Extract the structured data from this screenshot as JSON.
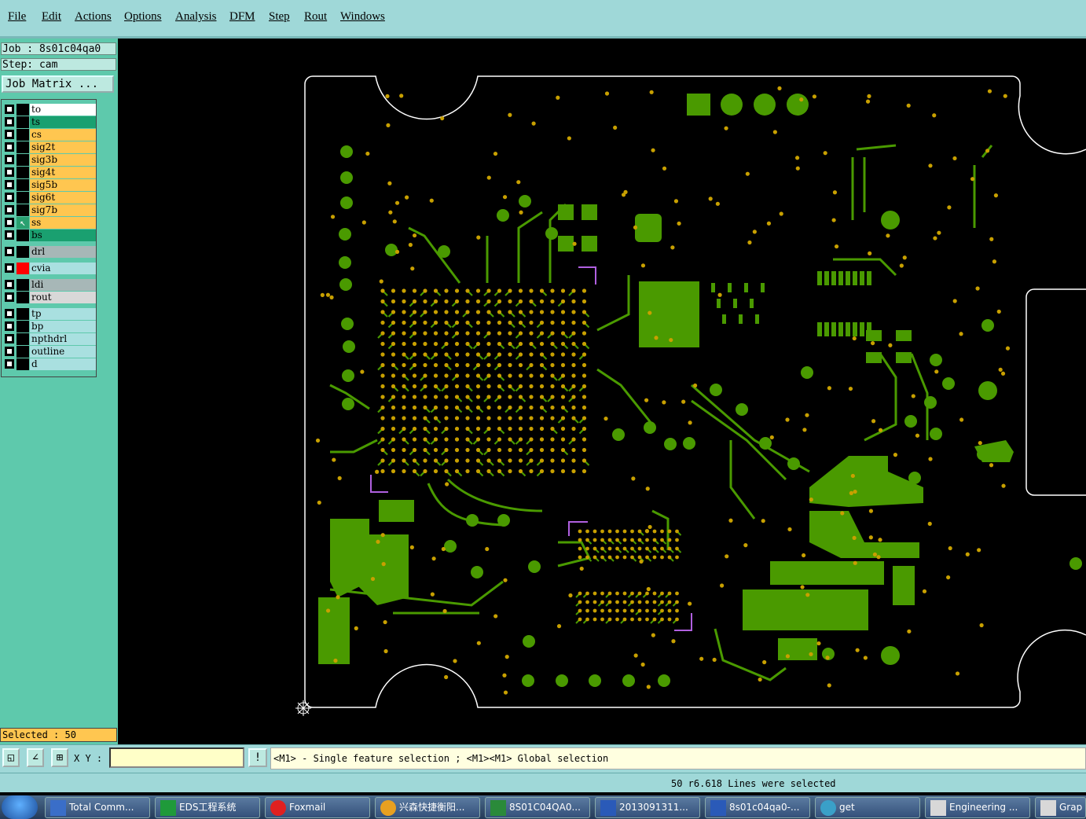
{
  "menu": [
    "File",
    "Edit",
    "Actions",
    "Options",
    "Analysis",
    "DFM",
    "Step",
    "Rout",
    "Windows"
  ],
  "job": "Job : 8s01c04qa0",
  "step": "Step: cam",
  "job_matrix_label": "Job Matrix ...",
  "layers": [
    {
      "name": "to",
      "color": "#ffffff"
    },
    {
      "name": "ts",
      "color": "#1aa070"
    },
    {
      "name": "cs",
      "color": "#ffc650"
    },
    {
      "name": "sig2t",
      "color": "#ffc650"
    },
    {
      "name": "sig3b",
      "color": "#ffc650"
    },
    {
      "name": "sig4t",
      "color": "#ffc650"
    },
    {
      "name": "sig5b",
      "color": "#ffc650"
    },
    {
      "name": "sig6t",
      "color": "#ffc650"
    },
    {
      "name": "sig7b",
      "color": "#ffc650"
    },
    {
      "name": "ss",
      "color": "#ffc650",
      "active": true
    },
    {
      "name": "bs",
      "color": "#1aa070"
    },
    {
      "name": "drl",
      "color": "#a7b7b7"
    },
    {
      "name": "cvia",
      "color": "#a9e0e0",
      "swatch": "#ff0000"
    },
    {
      "name": "ldi",
      "color": "#a7b7b7"
    },
    {
      "name": "rout",
      "color": "#d8d8d8"
    },
    {
      "name": "tp",
      "color": "#a9e0e0"
    },
    {
      "name": "bp",
      "color": "#a9e0e0"
    },
    {
      "name": "npthdrl",
      "color": "#a9e0e0"
    },
    {
      "name": "outline",
      "color": "#a9e0e0"
    },
    {
      "name": "d",
      "color": "#a9e0e0"
    }
  ],
  "selected": "Selected : 50",
  "xy_label": "X Y :",
  "xy_value": "",
  "message": "<M1> - Single feature selection ; <M1><M1> Global selection",
  "status": "50 r6.618 Lines were selected",
  "taskbar": [
    "Total Comm...",
    "EDS工程系统",
    "Foxmail",
    "兴森快捷衡阳...",
    "8S01C04QA0...",
    "2013091311...",
    "8s01c04qa0-...",
    "get",
    "Engineering ...",
    "Grap"
  ],
  "colors": {
    "trace": "#4a9a00",
    "pad": "#c8a000",
    "outline": "#ffffff",
    "marker": "#b060e0"
  }
}
